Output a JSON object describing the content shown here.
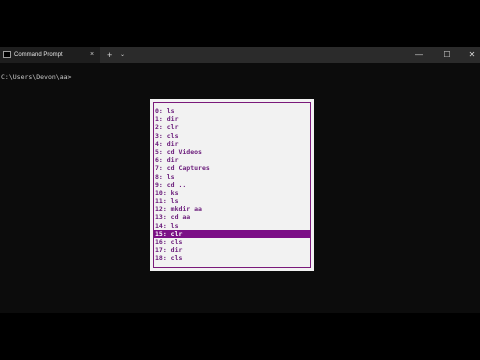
{
  "window": {
    "tab_title": "Command Prompt",
    "tab_close": "×",
    "new_tab": "+",
    "dropdown": "⌄",
    "minimize": "—",
    "maximize": "☐",
    "close": "✕"
  },
  "console": {
    "prompt": "C:\\Users\\Devon\\aa>"
  },
  "history": {
    "selected_index": 15,
    "items": [
      "0: ls",
      "1: dir",
      "2: clr",
      "3: cls",
      "4: dir",
      "5: cd Videos",
      "6: dir",
      "7: cd Captures",
      "8: ls",
      "9: cd ..",
      "10: ks",
      "11: ls",
      "12: mkdir aa",
      "13: cd aa",
      "14: ls",
      "15: clr",
      "16: cls",
      "17: dir",
      "18: cls"
    ]
  },
  "colors": {
    "popup_bg": "#f2f2f2",
    "popup_text": "#6a1b7a",
    "selected_bg": "#7b0f86",
    "console_bg": "#0c0c0c",
    "titlebar_bg": "#2b2b2b"
  }
}
